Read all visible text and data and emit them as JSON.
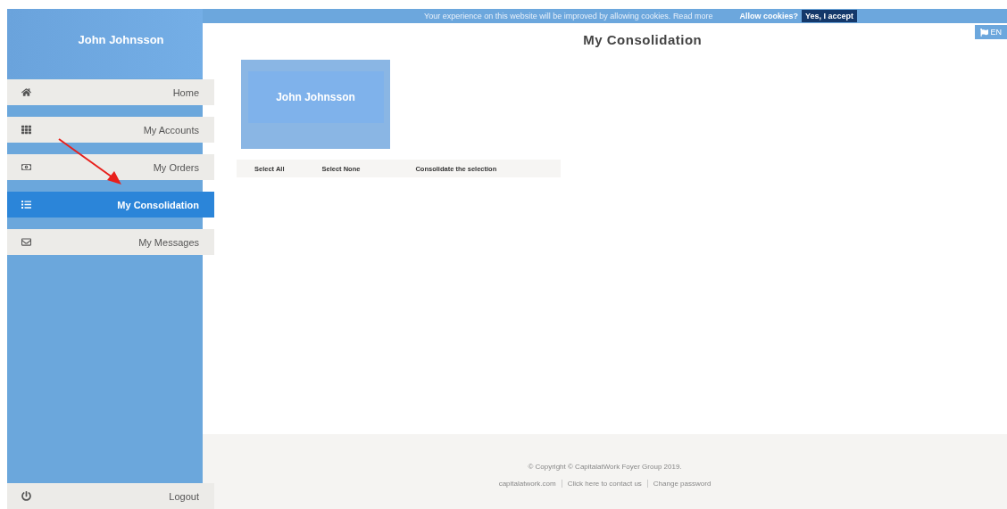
{
  "cookie_bar": {
    "message": "Your experience on this website will be improved by allowing cookies.",
    "read_more": "Read more",
    "prompt": "Allow cookies?",
    "accept_button": "Yes, I accept"
  },
  "sidebar": {
    "user_name": "John Johnsson",
    "items": [
      {
        "label": "Home",
        "selected": false
      },
      {
        "label": "My Accounts",
        "selected": false
      },
      {
        "label": "My Orders",
        "selected": false
      },
      {
        "label": "My Consolidation",
        "selected": true
      },
      {
        "label": "My Messages",
        "selected": false
      }
    ],
    "logout": {
      "label": "Logout"
    }
  },
  "language": "EN",
  "title": "My Consolidation",
  "account_card": {
    "name": "John Johnsson"
  },
  "actions": [
    "Select All",
    "Select None",
    "Consolidate the selection"
  ],
  "footer": {
    "copyright": "© Copyright © CapitalatWork Foyer Group 2019.",
    "links": [
      "capitalatwork.com",
      "Click here to contact us",
      "Change password"
    ]
  }
}
